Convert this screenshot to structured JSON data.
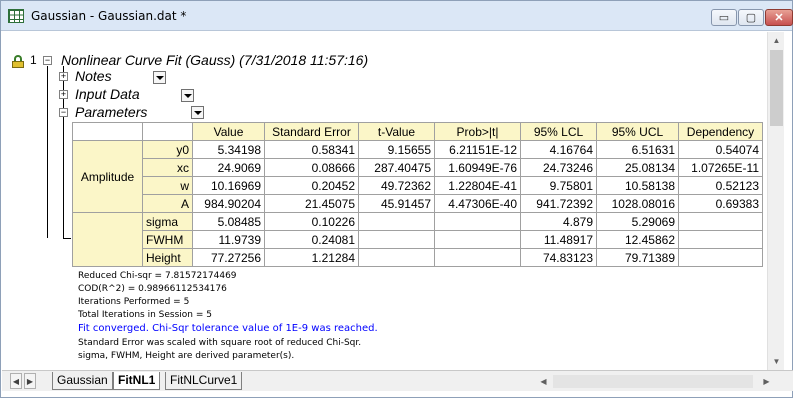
{
  "window": {
    "title": "Gaussian - Gaussian.dat *",
    "controls": {
      "minimize": "▭",
      "maximize": "▢",
      "close": "✕"
    }
  },
  "report": {
    "root_index": "1",
    "root_title": "Nonlinear Curve Fit (Gauss) (7/31/2018 11:57:16)",
    "sections": [
      "Notes",
      "Input Data",
      "Parameters"
    ],
    "parameters": {
      "columns": [
        "Value",
        "Standard Error",
        "t-Value",
        "Prob>|t|",
        "95% LCL",
        "95% UCL",
        "Dependency"
      ],
      "group_label": "Amplitude",
      "rows": [
        {
          "name": "y0",
          "cells": [
            "5.34198",
            "0.58341",
            "9.15655",
            "6.21151E-12",
            "4.16764",
            "6.51631",
            "0.54074"
          ]
        },
        {
          "name": "xc",
          "cells": [
            "24.9069",
            "0.08666",
            "287.40475",
            "1.60949E-76",
            "24.73246",
            "25.08134",
            "1.07265E-11"
          ]
        },
        {
          "name": "w",
          "cells": [
            "10.16969",
            "0.20452",
            "49.72362",
            "1.22804E-41",
            "9.75801",
            "10.58138",
            "0.52123"
          ]
        },
        {
          "name": "A",
          "cells": [
            "984.90204",
            "21.45075",
            "45.91457",
            "4.47306E-40",
            "941.72392",
            "1028.08016",
            "0.69383"
          ]
        },
        {
          "name": "sigma",
          "cells": [
            "5.08485",
            "0.10226",
            "",
            "",
            "4.879",
            "5.29069",
            ""
          ]
        },
        {
          "name": "FWHM",
          "cells": [
            "11.9739",
            "0.24081",
            "",
            "",
            "11.48917",
            "12.45862",
            ""
          ]
        },
        {
          "name": "Height",
          "cells": [
            "77.27256",
            "1.21284",
            "",
            "",
            "74.83123",
            "79.71389",
            ""
          ]
        }
      ],
      "notes": [
        "Reduced Chi-sqr = 7.81572174469",
        "COD(R^2) = 0.98966112534176",
        "Iterations Performed = 5",
        "Total Iterations in Session = 5"
      ],
      "converged_message": "Fit converged. Chi-Sqr tolerance value of 1E-9 was reached.",
      "footnotes": [
        "Standard Error was scaled with square root of reduced Chi-Sqr.",
        "sigma, FWHM, Height are derived parameter(s)."
      ]
    }
  },
  "tabs": [
    {
      "label": "Gaussian",
      "active": false
    },
    {
      "label": "FitNL1",
      "active": true
    },
    {
      "label": "FitNLCurve1",
      "active": false
    }
  ],
  "colors": {
    "header_bg": "#fbf6c8",
    "converged_text": "#0000ff",
    "title_bar": "#dbe7f6"
  }
}
